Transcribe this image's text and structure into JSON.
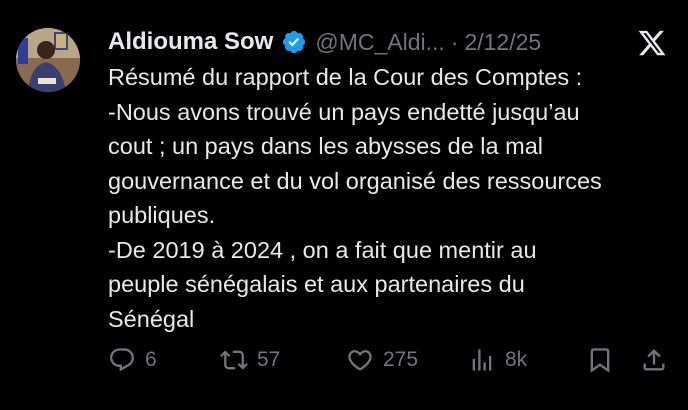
{
  "tweet": {
    "author_name": "Aldiouma Sow",
    "handle": "@MC_Aldi...",
    "separator": "·",
    "date": "2/12/25",
    "lines": [
      "Résumé du rapport de la Cour des Comptes :",
      "-Nous avons trouvé un pays endetté jusqu’au",
      "cout ; un pays dans les abysses de la mal",
      "gouvernance et du vol organisé des ressources",
      "publiques.",
      "-De 2019 à 2024 , on a fait que mentir au",
      "peuple sénégalais et aux partenaires du",
      "Sénégal"
    ],
    "stats": {
      "replies": "6",
      "retweets": "57",
      "likes": "275",
      "views": "8k"
    }
  },
  "colors": {
    "background": "#000000",
    "text": "#e7e9ea",
    "muted": "#71767b",
    "verified": "#1d9bf0"
  },
  "icons": {
    "verified": "verified-badge-icon",
    "brand": "x-logo-icon",
    "reply": "reply-icon",
    "retweet": "retweet-icon",
    "like": "heart-icon",
    "views": "views-icon",
    "bookmark": "bookmark-icon",
    "share": "share-icon"
  }
}
